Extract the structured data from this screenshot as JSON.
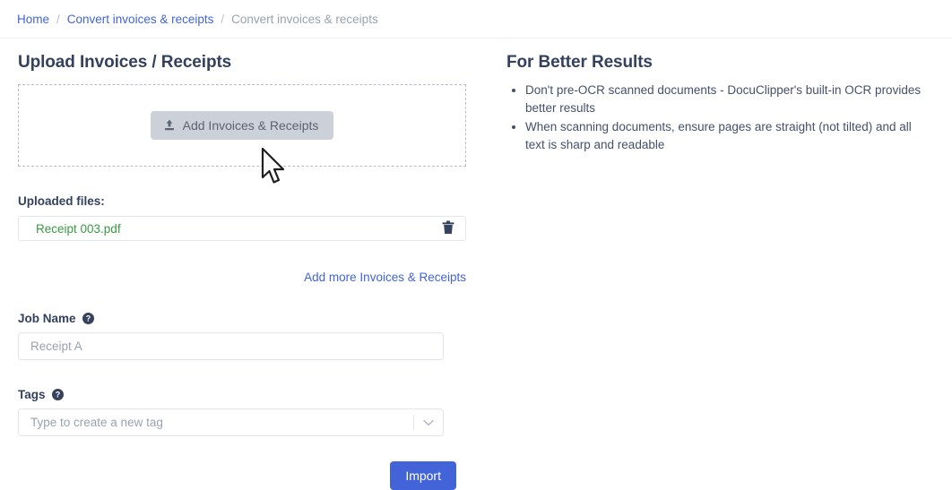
{
  "breadcrumb": {
    "home": "Home",
    "section": "Convert invoices & receipts",
    "current": "Convert invoices & receipts",
    "separator": "/"
  },
  "upload": {
    "title": "Upload Invoices / Receipts",
    "add_button_label": "Add Invoices & Receipts",
    "uploaded_files_label": "Uploaded files:",
    "files": [
      {
        "name": "Receipt 003.pdf"
      }
    ],
    "add_more_label": "Add more Invoices & Receipts"
  },
  "form": {
    "job_name": {
      "label": "Job Name",
      "value": "",
      "placeholder": "Receipt A"
    },
    "tags": {
      "label": "Tags",
      "value": "",
      "placeholder": "Type to create a new tag"
    },
    "submit_label": "Import"
  },
  "tips": {
    "title": "For Better Results",
    "items": [
      "Don't pre-OCR scanned documents - DocuClipper's built-in OCR provides better results",
      "When scanning documents, ensure pages are straight (not tilted) and all text is sharp and readable"
    ]
  },
  "colors": {
    "accent": "#4264d8",
    "file_success": "#3a9a42",
    "heading": "#33415c",
    "muted": "#9aa2ae"
  }
}
